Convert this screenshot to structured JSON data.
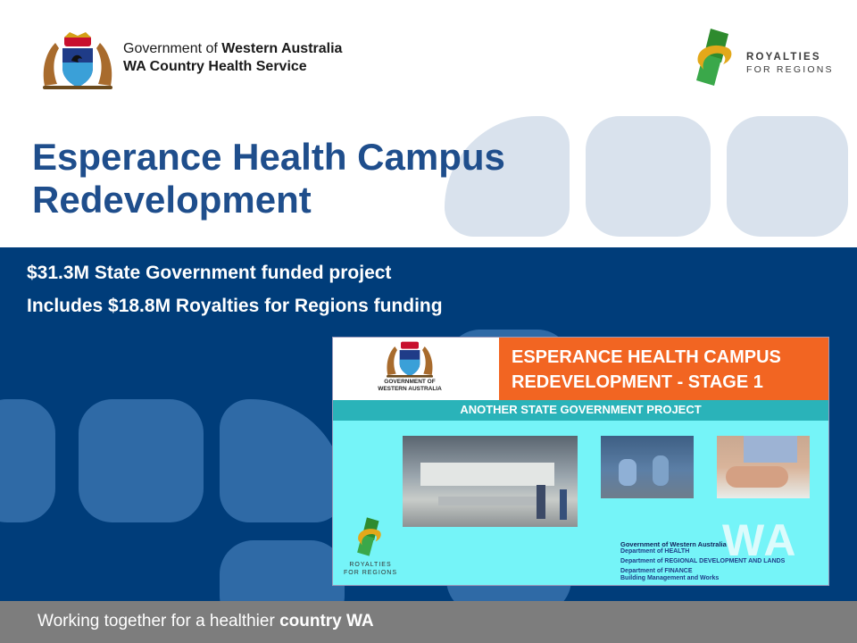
{
  "header": {
    "gov_line1_plain": "Government of ",
    "gov_line1_bold": "Western Australia",
    "gov_line2": "WA Country Health Service",
    "rfr_line1": "ROYALTIES",
    "rfr_line2": "FOR REGIONS"
  },
  "title_line1": "Esperance Health Campus",
  "title_line2": "Redevelopment",
  "subtitle_lines": [
    "$31.3M State Government funded project",
    "Includes $18.8M Royalties for Regions funding"
  ],
  "sign": {
    "crest_caption_line1": "GOVERNMENT OF",
    "crest_caption_line2": "WESTERN AUSTRALIA",
    "heading_line1": "ESPERANCE HEALTH CAMPUS",
    "heading_line2": "REDEVELOPMENT - STAGE 1",
    "strip": "ANOTHER STATE GOVERNMENT PROJECT",
    "wa_mark": "WA",
    "rfr_line1": "ROYALTIES",
    "rfr_line2": "FOR REGIONS",
    "gov_block": {
      "title": "Government of Western Australia",
      "lines": [
        "Department of HEALTH",
        "Department of REGIONAL DEVELOPMENT AND LANDS",
        "Department of FINANCE",
        "Building Management and Works"
      ]
    }
  },
  "footer": {
    "plain": "Working together for a healthier ",
    "bold": "country WA"
  },
  "colors": {
    "title_blue": "#1f4e8c",
    "band_blue": "#003d7a",
    "footer_grey": "#7d7d7d",
    "sign_orange": "#f26522",
    "sign_cyan": "#75f4f8",
    "rfr_green": "#2e8b2e",
    "rfr_gold": "#e3a81a"
  }
}
